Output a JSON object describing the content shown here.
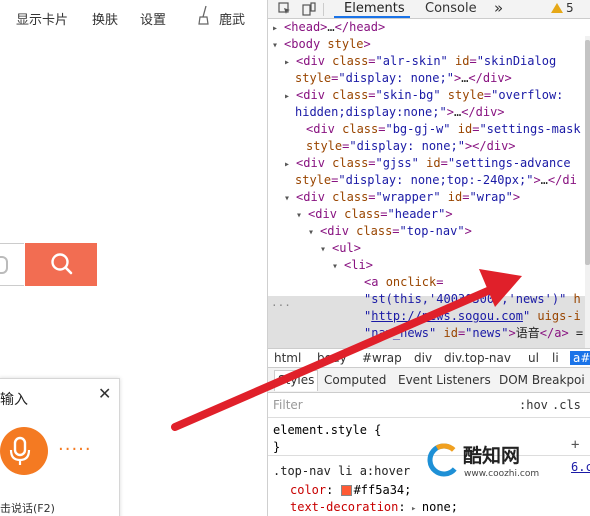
{
  "left_page": {
    "nav": [
      "显示卡片",
      "换肤",
      "设置",
      "鹿武"
    ],
    "voice_panel": {
      "title": "输入",
      "close": "✕",
      "dots": "·····",
      "hint": "击说话(F2)"
    }
  },
  "devtools": {
    "tabs": [
      "Elements",
      "Console"
    ],
    "more": "»",
    "warnings": "5",
    "dom_lines": [
      {
        "indent": 16,
        "tri": "▸",
        "parts": [
          [
            "tag",
            "<head>"
          ],
          [
            "txt",
            "…"
          ],
          [
            "tag",
            "</head>"
          ]
        ]
      },
      {
        "indent": 16,
        "tri": "▾",
        "parts": [
          [
            "tag",
            "<body "
          ],
          [
            "attr",
            "style"
          ],
          [
            "tag",
            ">"
          ]
        ]
      },
      {
        "indent": 28,
        "tri": "▸",
        "parts": [
          [
            "tag",
            "<div "
          ],
          [
            "attr",
            "class"
          ],
          [
            "tag",
            "="
          ],
          [
            "val",
            "\"alr-skin\""
          ],
          [
            "tag",
            " "
          ],
          [
            "attr",
            "id"
          ],
          [
            "tag",
            "="
          ],
          [
            "val",
            "\"skinDialog"
          ]
        ]
      },
      {
        "indent": 27,
        "tri": "",
        "parts": [
          [
            "attr",
            "style"
          ],
          [
            "tag",
            "="
          ],
          [
            "val",
            "\"display: none;\""
          ],
          [
            "tag",
            ">"
          ],
          [
            "txt",
            "…"
          ],
          [
            "tag",
            "</div>"
          ]
        ]
      },
      {
        "indent": 28,
        "tri": "▸",
        "parts": [
          [
            "tag",
            "<div "
          ],
          [
            "attr",
            "class"
          ],
          [
            "tag",
            "="
          ],
          [
            "val",
            "\"skin-bg\""
          ],
          [
            "tag",
            " "
          ],
          [
            "attr",
            "style"
          ],
          [
            "tag",
            "="
          ],
          [
            "val",
            "\"overflow:"
          ]
        ]
      },
      {
        "indent": 27,
        "tri": "",
        "parts": [
          [
            "val",
            "hidden;display:none;\""
          ],
          [
            "tag",
            ">"
          ],
          [
            "txt",
            "…"
          ],
          [
            "tag",
            "</div>"
          ]
        ]
      },
      {
        "indent": 38,
        "tri": "",
        "parts": [
          [
            "tag",
            "<div "
          ],
          [
            "attr",
            "class"
          ],
          [
            "tag",
            "="
          ],
          [
            "val",
            "\"bg-gj-w\""
          ],
          [
            "tag",
            " "
          ],
          [
            "attr",
            "id"
          ],
          [
            "tag",
            "="
          ],
          [
            "val",
            "\"settings-mask"
          ]
        ]
      },
      {
        "indent": 38,
        "tri": "",
        "parts": [
          [
            "attr",
            "style"
          ],
          [
            "tag",
            "="
          ],
          [
            "val",
            "\"display: none;\""
          ],
          [
            "tag",
            "></div>"
          ]
        ]
      },
      {
        "indent": 28,
        "tri": "▸",
        "parts": [
          [
            "tag",
            "<div "
          ],
          [
            "attr",
            "class"
          ],
          [
            "tag",
            "="
          ],
          [
            "val",
            "\"gjss\""
          ],
          [
            "tag",
            " "
          ],
          [
            "attr",
            "id"
          ],
          [
            "tag",
            "="
          ],
          [
            "val",
            "\"settings-advance"
          ]
        ]
      },
      {
        "indent": 27,
        "tri": "",
        "parts": [
          [
            "attr",
            "style"
          ],
          [
            "tag",
            "="
          ],
          [
            "val",
            "\"display: none;top:-240px;\""
          ],
          [
            "tag",
            ">"
          ],
          [
            "txt",
            "…"
          ],
          [
            "tag",
            "</di"
          ]
        ]
      },
      {
        "indent": 28,
        "tri": "▾",
        "parts": [
          [
            "tag",
            "<div "
          ],
          [
            "attr",
            "class"
          ],
          [
            "tag",
            "="
          ],
          [
            "val",
            "\"wrapper\""
          ],
          [
            "tag",
            " "
          ],
          [
            "attr",
            "id"
          ],
          [
            "tag",
            "="
          ],
          [
            "val",
            "\"wrap\""
          ],
          [
            "tag",
            ">"
          ]
        ]
      },
      {
        "indent": 40,
        "tri": "▾",
        "parts": [
          [
            "tag",
            "<div "
          ],
          [
            "attr",
            "class"
          ],
          [
            "tag",
            "="
          ],
          [
            "val",
            "\"header\""
          ],
          [
            "tag",
            ">"
          ]
        ]
      },
      {
        "indent": 52,
        "tri": "▾",
        "parts": [
          [
            "tag",
            "<div "
          ],
          [
            "attr",
            "class"
          ],
          [
            "tag",
            "="
          ],
          [
            "val",
            "\"top-nav\""
          ],
          [
            "tag",
            ">"
          ]
        ]
      },
      {
        "indent": 64,
        "tri": "▾",
        "parts": [
          [
            "tag",
            "<ul>"
          ]
        ]
      },
      {
        "indent": 76,
        "tri": "▾",
        "parts": [
          [
            "tag",
            "<li>"
          ]
        ]
      },
      {
        "indent": 96,
        "tri": "",
        "parts": [
          [
            "tag",
            "<a "
          ],
          [
            "attr",
            "onclick"
          ],
          [
            "tag",
            "="
          ]
        ]
      },
      {
        "indent": 96,
        "tri": "",
        "parts": [
          [
            "val",
            "\"st(this,'40030300','news')\""
          ],
          [
            "tag",
            " "
          ],
          [
            "attr",
            "h"
          ]
        ]
      },
      {
        "indent": 96,
        "tri": "",
        "parts": [
          [
            "val",
            "\""
          ],
          [
            "link",
            "http://news.sogou.com"
          ],
          [
            "val",
            "\""
          ],
          [
            "tag",
            " "
          ],
          [
            "attr",
            "uigs-i"
          ]
        ]
      },
      {
        "indent": 96,
        "tri": "",
        "parts": [
          [
            "val",
            "\"nav_news\""
          ],
          [
            "tag",
            " "
          ],
          [
            "attr",
            "id"
          ],
          [
            "tag",
            "="
          ],
          [
            "val",
            "\"news\""
          ],
          [
            "tag",
            ">"
          ],
          [
            "txt",
            "语音"
          ],
          [
            "tag",
            "</a>"
          ],
          [
            "txt",
            " ="
          ]
        ]
      }
    ],
    "dom_ellipsis": "···",
    "breadcrumbs": [
      "html",
      "body",
      "#wrap",
      "div",
      "div.top-nav",
      "ul",
      "li",
      "a#"
    ],
    "styles_tabs": [
      "Styles",
      "Computed",
      "Event Listeners",
      "DOM Breakpoi"
    ],
    "filter_placeholder": "Filter",
    "hov": ":hov",
    "cls": ".cls",
    "plus": "+",
    "rules": [
      {
        "selector": "element.style {",
        "lines": [
          "}"
        ]
      },
      {
        "selector": ".top-nav li a:hover",
        "props": [
          {
            "name": "color",
            "value": "#ff5a34;",
            "swatch": "#ff5a34"
          },
          {
            "name": "text-decoration",
            "value": "none;"
          }
        ]
      }
    ],
    "rule_source": "6.c"
  },
  "watermark": {
    "name": "酷知网",
    "url": "www.coozhi.com"
  },
  "colors": {
    "arrow": "#e0202a",
    "search_btn": "#f26d52",
    "mic": "#f47a22",
    "accent": "#1a73e8"
  }
}
